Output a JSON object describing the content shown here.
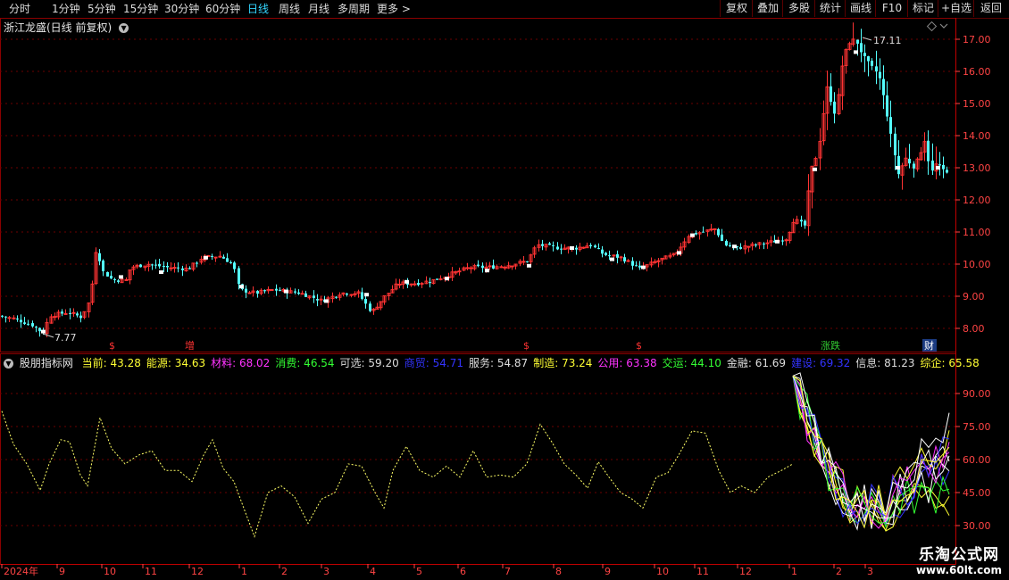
{
  "toolbar": {
    "periods": [
      "分时",
      "1分钟",
      "5分钟",
      "15分钟",
      "30分钟",
      "60分钟",
      "日线",
      "周线",
      "月线",
      "多周期",
      "更多 >"
    ],
    "active_period": "日线",
    "buttons": [
      "复权",
      "叠加",
      "多股",
      "统计",
      "画线",
      "F10",
      "标记",
      "+自选",
      "返回"
    ]
  },
  "main_chart": {
    "title": "浙江龙盛(日线 前复权)",
    "price_axis": [
      "17.00",
      "16.00",
      "15.00",
      "14.00",
      "13.00",
      "12.00",
      "11.00",
      "10.00",
      "9.00",
      "8.00"
    ],
    "high_label": "17.11",
    "low_label": "7.77",
    "markers": [
      {
        "text": "$",
        "color": "#ff3333"
      },
      {
        "text": "增",
        "color": "#ff3333"
      },
      {
        "text": "$",
        "color": "#ff3333"
      },
      {
        "text": "$",
        "color": "#ff3333"
      },
      {
        "text": "涨跌",
        "color": "#33cc33"
      },
      {
        "text": "财",
        "color": "#ffffff"
      }
    ]
  },
  "indicator": {
    "name": "股朋指标网",
    "items": [
      {
        "label": "当前:",
        "value": "43.28",
        "color": "#ffff33"
      },
      {
        "label": "能源:",
        "value": "34.63",
        "color": "#ffff33"
      },
      {
        "label": "材料:",
        "value": "68.02",
        "color": "#ff33ff"
      },
      {
        "label": "消费:",
        "value": "46.54",
        "color": "#33ff33"
      },
      {
        "label": "可选:",
        "value": "59.20",
        "color": "#dddddd"
      },
      {
        "label": "商贸:",
        "value": "54.71",
        "color": "#3333ff"
      },
      {
        "label": "服务:",
        "value": "54.87",
        "color": "#dddddd"
      },
      {
        "label": "制造:",
        "value": "73.24",
        "color": "#ffff33"
      },
      {
        "label": "公用:",
        "value": "63.38",
        "color": "#ff33ff"
      },
      {
        "label": "交运:",
        "value": "44.10",
        "color": "#33ff33"
      },
      {
        "label": "金融:",
        "value": "61.69",
        "color": "#dddddd"
      },
      {
        "label": "建设:",
        "value": "69.32",
        "color": "#3333ff"
      },
      {
        "label": "信息:",
        "value": "81.23",
        "color": "#dddddd"
      },
      {
        "label": "综企:",
        "value": "65.58",
        "color": "#ffff33"
      }
    ],
    "axis": [
      "90.00",
      "75.00",
      "60.00",
      "45.00",
      "30.00"
    ]
  },
  "time_axis": [
    "2024年",
    "9",
    "10",
    "11",
    "12",
    "1",
    "2",
    "3",
    "4",
    "5",
    "6",
    "7",
    "8",
    "9",
    "10",
    "11",
    "12",
    "1",
    "2",
    "3"
  ],
  "watermark": {
    "line1": "乐淘公式网",
    "line2": "www.60lt.com"
  },
  "colors": {
    "up": "#ff3333",
    "down": "#54ffff",
    "grid": "#8b0000",
    "axis": "#ff4444",
    "ma": "#ffffff"
  }
}
